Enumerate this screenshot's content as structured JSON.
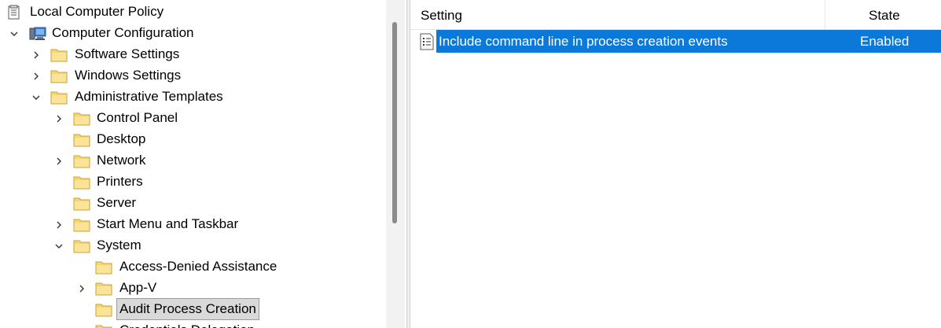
{
  "tree": {
    "root_label": "Local Computer Policy",
    "items": [
      {
        "label": "Computer Configuration"
      },
      {
        "label": "Software Settings"
      },
      {
        "label": "Windows Settings"
      },
      {
        "label": "Administrative Templates"
      },
      {
        "label": "Control Panel"
      },
      {
        "label": "Desktop"
      },
      {
        "label": "Network"
      },
      {
        "label": "Printers"
      },
      {
        "label": "Server"
      },
      {
        "label": "Start Menu and Taskbar"
      },
      {
        "label": "System"
      },
      {
        "label": "Access-Denied Assistance"
      },
      {
        "label": "App-V"
      },
      {
        "label": "Audit Process Creation"
      },
      {
        "label": "Credentials Delegation"
      }
    ],
    "selected_label": "Audit Process Creation"
  },
  "list": {
    "columns": {
      "setting": "Setting",
      "state": "State"
    },
    "rows": [
      {
        "setting": "Include command line in process creation events",
        "state": "Enabled"
      }
    ]
  },
  "colors": {
    "selection_accent": "#0a79d9",
    "folder_yellow": "#f7d66a",
    "tree_selected_bg": "#d9d9d9"
  },
  "icons": {
    "root": "policy-document-icon",
    "computer": "computer-icon",
    "folder": "folder-icon",
    "setting": "policy-setting-icon",
    "expand": "chevron-right-icon",
    "collapse": "chevron-down-icon"
  }
}
